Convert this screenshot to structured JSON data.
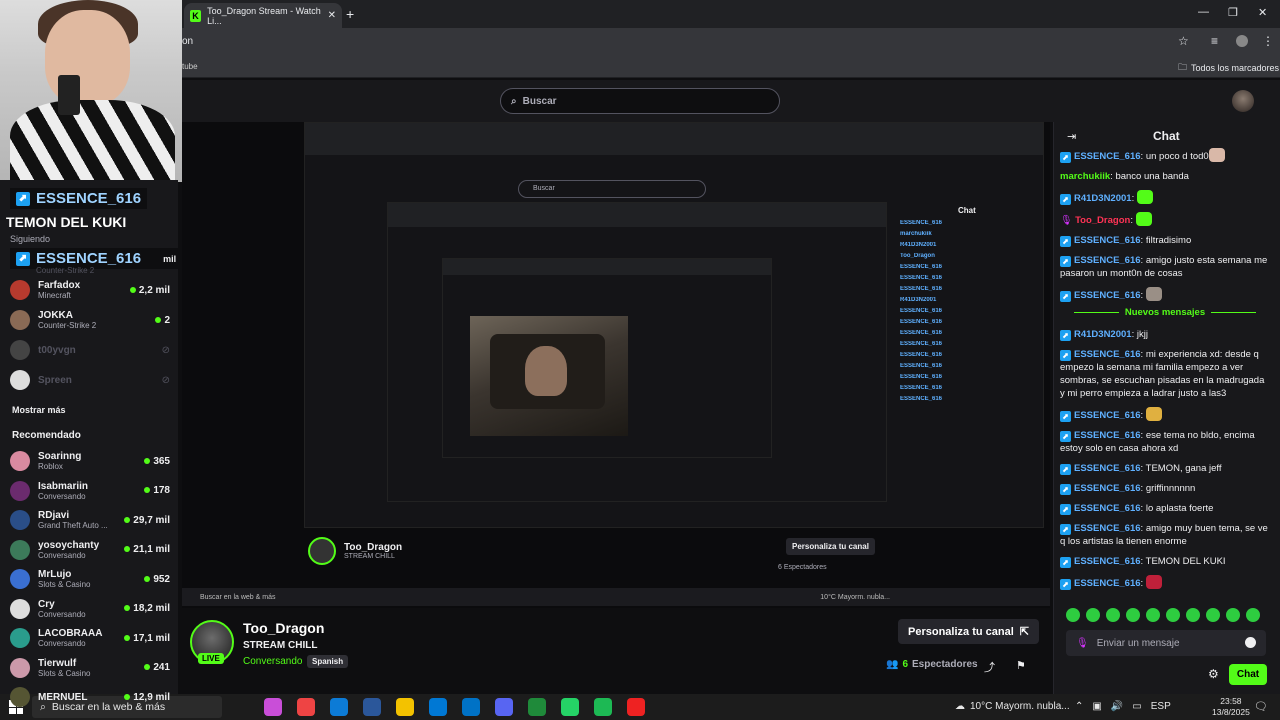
{
  "browser": {
    "tab_title": "Too_Dragon Stream - Watch Li...",
    "new_tab": "+",
    "address_fragment": "on",
    "bookmark_left": "tube",
    "bookmarks_folder": "Todos los marcadores"
  },
  "kick": {
    "search_placeholder": "Buscar"
  },
  "overlay": {
    "tag": "ESSENCE_616",
    "text": "TEMON DEL KUKI",
    "following": "Siguiendo",
    "tag2": "ESSENCE_616",
    "tag2_suffix": "mil",
    "tag2_sub": "Counter-Strike 2"
  },
  "sidebar": {
    "following": [
      {
        "name": "Farfadox",
        "sub": "Minecraft",
        "viewers": "2,2 mil",
        "color": "#b73a2e"
      },
      {
        "name": "JOKKA",
        "sub": "Counter-Strike 2",
        "viewers": "2",
        "color": "#8a6a55"
      },
      {
        "name": "t00yvgn",
        "sub": "",
        "viewers": "",
        "color": "#444"
      },
      {
        "name": "Spreen",
        "sub": "",
        "viewers": "",
        "color": "#ddd"
      }
    ],
    "show_more": "Mostrar más",
    "recommended_label": "Recomendado",
    "recommended": [
      {
        "name": "Soarinng",
        "sub": "Roblox",
        "viewers": "365",
        "color": "#d98aa0"
      },
      {
        "name": "Isabmariin",
        "sub": "Conversando",
        "viewers": "178",
        "color": "#6b2b6e"
      },
      {
        "name": "RDjavi",
        "sub": "Grand Theft Auto ...",
        "viewers": "29,7 mil",
        "color": "#2a4e88"
      },
      {
        "name": "yosoychanty",
        "sub": "Conversando",
        "viewers": "21,1 mil",
        "color": "#3c7a5a"
      },
      {
        "name": "MrLujo",
        "sub": "Slots & Casino",
        "viewers": "952",
        "color": "#3a6fd1"
      },
      {
        "name": "Cry",
        "sub": "Conversando",
        "viewers": "18,2 mil",
        "color": "#ddd"
      },
      {
        "name": "LACOBRAAA",
        "sub": "Conversando",
        "viewers": "17,1 mil",
        "color": "#2a9c8c"
      },
      {
        "name": "Tierwulf",
        "sub": "Slots & Casino",
        "viewers": "241",
        "color": "#c9a"
      },
      {
        "name": "MERNUEL",
        "sub": "",
        "viewers": "12,9 mil",
        "color": "#553"
      }
    ]
  },
  "stream": {
    "name": "Too_Dragon",
    "title": "STREAM CHILL",
    "category": "Conversando",
    "language": "Spanish",
    "live": "LIVE",
    "personalize": "Personaliza tu canal",
    "viewers_count": "6",
    "viewers_label": "Espectadores"
  },
  "chat": {
    "title": "Chat",
    "new_messages": "Nuevos mensajes",
    "input_placeholder": "Enviar un mensaje",
    "send": "Chat",
    "messages_before": [
      {
        "user": "ESSENCE_616",
        "color": "#5fb0ff",
        "text": "un poco d tod0",
        "emote": "#d9b8a8",
        "badge": "kick"
      },
      {
        "user": "marchukiik",
        "color": "#53fc18",
        "text": "banco una banda",
        "emote": "",
        "badge": ""
      },
      {
        "user": "R41D3N2001",
        "color": "#5fb0ff",
        "text": "",
        "emote": "#53fc18",
        "badge": "kick"
      },
      {
        "user": "Too_Dragon",
        "color": "#ff3355",
        "text": "",
        "emote": "#53fc18",
        "badge": "mic"
      },
      {
        "user": "ESSENCE_616",
        "color": "#5fb0ff",
        "text": "filtradisimo",
        "emote": "",
        "badge": "kick"
      },
      {
        "user": "ESSENCE_616",
        "color": "#5fb0ff",
        "text": "amigo justo esta semana me pasaron un mont0n de cosas",
        "emote": "",
        "badge": "kick"
      },
      {
        "user": "ESSENCE_616",
        "color": "#5fb0ff",
        "text": "",
        "emote": "#9a8f86",
        "badge": "kick"
      }
    ],
    "messages_after": [
      {
        "user": "R41D3N2001",
        "color": "#5fb0ff",
        "text": "jkjj",
        "emote": "",
        "badge": "kick"
      },
      {
        "user": "ESSENCE_616",
        "color": "#5fb0ff",
        "text": "mi experiencia xd: desde q empezo la semana mi familia empezo a ver sombras, se escuchan pisadas en la madrugada y mi perro empieza a ladrar justo a las3",
        "emote": "",
        "badge": "kick"
      },
      {
        "user": "ESSENCE_616",
        "color": "#5fb0ff",
        "text": "",
        "emote": "#e0b040",
        "badge": "kick"
      },
      {
        "user": "ESSENCE_616",
        "color": "#5fb0ff",
        "text": "ese tema no bldo, encima estoy solo en casa ahora xd",
        "emote": "",
        "badge": "kick"
      },
      {
        "user": "ESSENCE_616",
        "color": "#5fb0ff",
        "text": "TEMON, gana jeff",
        "emote": "",
        "badge": "kick"
      },
      {
        "user": "ESSENCE_616",
        "color": "#5fb0ff",
        "text": "griffinnnnnn",
        "emote": "",
        "badge": "kick"
      },
      {
        "user": "ESSENCE_616",
        "color": "#5fb0ff",
        "text": "lo aplasta foerte",
        "emote": "",
        "badge": "kick"
      },
      {
        "user": "ESSENCE_616",
        "color": "#5fb0ff",
        "text": "amigo muy buen tema, se ve q los artistas la tienen enorme",
        "emote": "",
        "badge": "kick"
      },
      {
        "user": "ESSENCE_616",
        "color": "#5fb0ff",
        "text": "TEMON DEL KUKI",
        "emote": "",
        "badge": "kick"
      },
      {
        "user": "ESSENCE_616",
        "color": "#5fb0ff",
        "text": "",
        "emote": "#c0203a",
        "badge": "kick"
      }
    ]
  },
  "taskbar": {
    "search_placeholder": "Buscar en la web & más",
    "weather": "10°C  Mayorm. nubla...",
    "lang": "ESP",
    "time": "23:58",
    "date": "13/8/2025",
    "apps": [
      "#c94ed8",
      "#e44",
      "#0c7bd6",
      "#2b579a",
      "#f3c200",
      "#0078d4",
      "#0072c6",
      "#5865f2",
      "#1f8a3a",
      "#25d366",
      "#1db954",
      "#e22"
    ]
  },
  "nested": {
    "search": "Buscar",
    "mini_name": "Too_Dragon",
    "mini_title": "STREAM CHILL",
    "mini_personalize": "Personaliza tu canal",
    "mini_viewers": "6 Espectadores",
    "mini_chat_title": "Chat",
    "mini_taskbar": "Buscar en la web & más",
    "mini_weather": "10°C  Mayorm. nubla..."
  }
}
